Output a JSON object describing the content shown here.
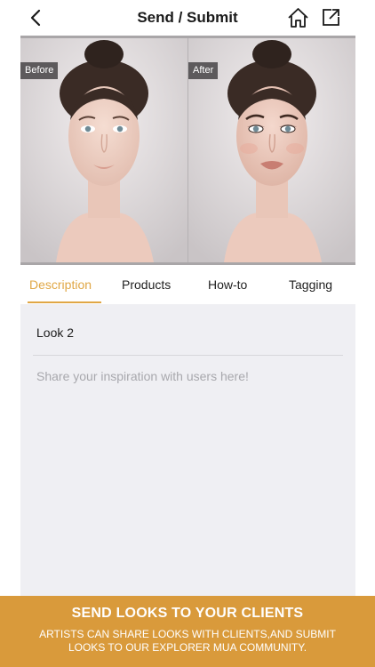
{
  "header": {
    "title": "Send / Submit",
    "back_icon": "chevron-left-icon",
    "home_icon": "home-icon",
    "share_icon": "share-external-icon"
  },
  "compare": {
    "before_label": "Before",
    "after_label": "After"
  },
  "tabs": [
    {
      "label": "Description",
      "active": true
    },
    {
      "label": "Products",
      "active": false
    },
    {
      "label": "How-to",
      "active": false
    },
    {
      "label": "Tagging",
      "active": false
    }
  ],
  "description": {
    "look_name": "Look 2",
    "placeholder": "Share your inspiration with users here!"
  },
  "banner": {
    "title": "SEND LOOKS TO YOUR CLIENTS",
    "subtitle": "ARTISTS CAN SHARE LOOKS WITH CLIENTS,AND SUBMIT LOOKS TO OUR EXPLORER MUA COMMUNITY."
  },
  "colors": {
    "accent": "#e0a745",
    "banner": "#d99a3b",
    "content_bg": "#efeff3"
  }
}
